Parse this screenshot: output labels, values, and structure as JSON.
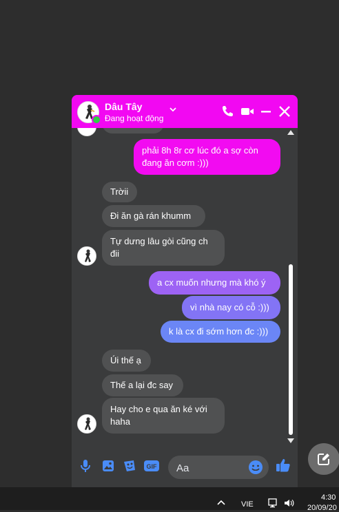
{
  "header": {
    "name": "Dâu Tây",
    "status": "Đang hoạt động"
  },
  "messages": {
    "out1": "phải 8h 8r cơ lúc đó a sợ còn đang ăn cơm :)))",
    "in1": "Trờii",
    "in2": "Đi ăn gà rán khumm",
    "in3": "Tự dưng lâu gòi cũng ch đii",
    "out2": "a cx muốn nhưng mà khó ý",
    "out3": "vì nhà nay có cỗ :)))",
    "out4": "k là cx đi sớm hơn đc :)))",
    "in4": "Úi thế ạ",
    "in5": "Thế a lại đc say",
    "in6": "Hay cho e qua ăn ké với haha"
  },
  "composer": {
    "placeholder": "Aa"
  },
  "taskbar": {
    "language": "VIE",
    "time": "4:30",
    "date": "20/09/20"
  },
  "colors": {
    "header": "#f208f2",
    "out_top": "#f20bf1",
    "out_mid": "#9d63f4",
    "out_bottom": "#6b86f6",
    "accent_icons": "#4a8cf7"
  },
  "icons": {
    "phone": "phone-icon",
    "video": "video-icon",
    "minimize": "minimize-icon",
    "close": "close-icon",
    "mic": "microphone-icon",
    "image": "image-icon",
    "sticker": "sticker-icon",
    "gif": "gif-icon",
    "emoji": "emoji-icon",
    "like": "thumbs-up-icon",
    "compose": "compose-icon"
  }
}
